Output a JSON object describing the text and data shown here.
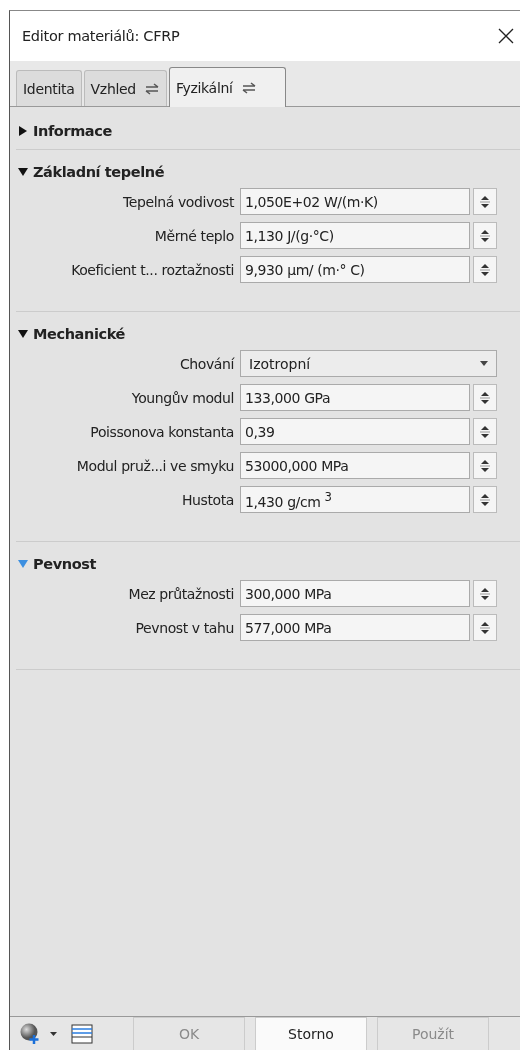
{
  "window": {
    "title": "Editor materiálů: CFRP"
  },
  "tabs": [
    {
      "label": "Identita",
      "selected": false,
      "sync_icon": false
    },
    {
      "label": "Vzhled",
      "selected": false,
      "sync_icon": true
    },
    {
      "label": "Fyzikální",
      "selected": true,
      "sync_icon": true
    }
  ],
  "sections": [
    {
      "title": "Informace",
      "expanded": false,
      "hovered": false
    },
    {
      "title": "Základní tepelné",
      "expanded": true,
      "hovered": false,
      "rows": [
        {
          "label": "Tepelná vodivost",
          "kind": "spin",
          "value": "1,050E+02 W/(m·K)"
        },
        {
          "label": "Měrné teplo",
          "kind": "spin",
          "value": "1,130 J/(g·°C)"
        },
        {
          "label": "Koeficient t... roztažnosti",
          "kind": "spin",
          "value": "9,930 µm/ (m·° C)"
        }
      ]
    },
    {
      "title": "Mechanické",
      "expanded": true,
      "hovered": false,
      "rows": [
        {
          "label": "Chování",
          "kind": "dropdown",
          "value": "Izotropní"
        },
        {
          "label": "Youngův modul",
          "kind": "spin",
          "value": "133,000 GPa"
        },
        {
          "label": "Poissonova konstanta",
          "kind": "spin",
          "value": "0,39"
        },
        {
          "label": "Modul pruž...i ve smyku",
          "kind": "spin",
          "value": "53000,000 MPa"
        },
        {
          "label": "Hustota",
          "kind": "spin",
          "value": "1,430 g/cm $^{3}$"
        }
      ]
    },
    {
      "title": "Pevnost",
      "expanded": true,
      "hovered": true,
      "rows": [
        {
          "label": "Mez průtažnosti",
          "kind": "spin",
          "value": "300,000 MPa"
        },
        {
          "label": "Pevnost v tahu",
          "kind": "spin",
          "value": "577,000 MPa"
        }
      ]
    }
  ],
  "footer": {
    "buttons": [
      {
        "label": "OK",
        "disabled": true,
        "default": false
      },
      {
        "label": "Storno",
        "disabled": false,
        "default": true
      },
      {
        "label": "Použít",
        "disabled": true,
        "default": false
      }
    ]
  }
}
